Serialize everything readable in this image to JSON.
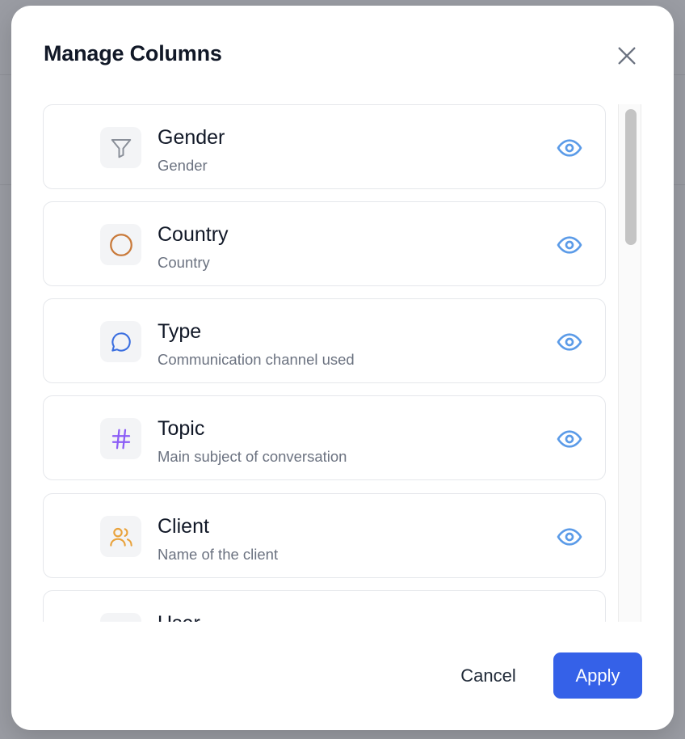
{
  "dialog": {
    "title": "Manage Columns",
    "close_icon": "close-icon"
  },
  "columns": [
    {
      "name": "Gender",
      "description": "Gender",
      "icon": "filter-icon",
      "icon_color": "#8a8f99",
      "visible": true
    },
    {
      "name": "Country",
      "description": "Country",
      "icon": "circle-icon",
      "icon_color": "#c97a3a",
      "visible": true
    },
    {
      "name": "Type",
      "description": "Communication channel used",
      "icon": "chat-bubble-icon",
      "icon_color": "#3b6fe0",
      "visible": true
    },
    {
      "name": "Topic",
      "description": "Main subject of conversation",
      "icon": "hashtag-icon",
      "icon_color": "#8b5cf6",
      "visible": true
    },
    {
      "name": "Client",
      "description": "Name of the client",
      "icon": "users-icon",
      "icon_color": "#e9a23b",
      "visible": true
    },
    {
      "name": "User",
      "description": "",
      "icon": "user-icon",
      "icon_color": "#8a8f99",
      "visible": true
    }
  ],
  "footer": {
    "cancel_label": "Cancel",
    "apply_label": "Apply"
  },
  "colors": {
    "accent": "#3561e8",
    "eye_icon": "#5b9be8"
  }
}
